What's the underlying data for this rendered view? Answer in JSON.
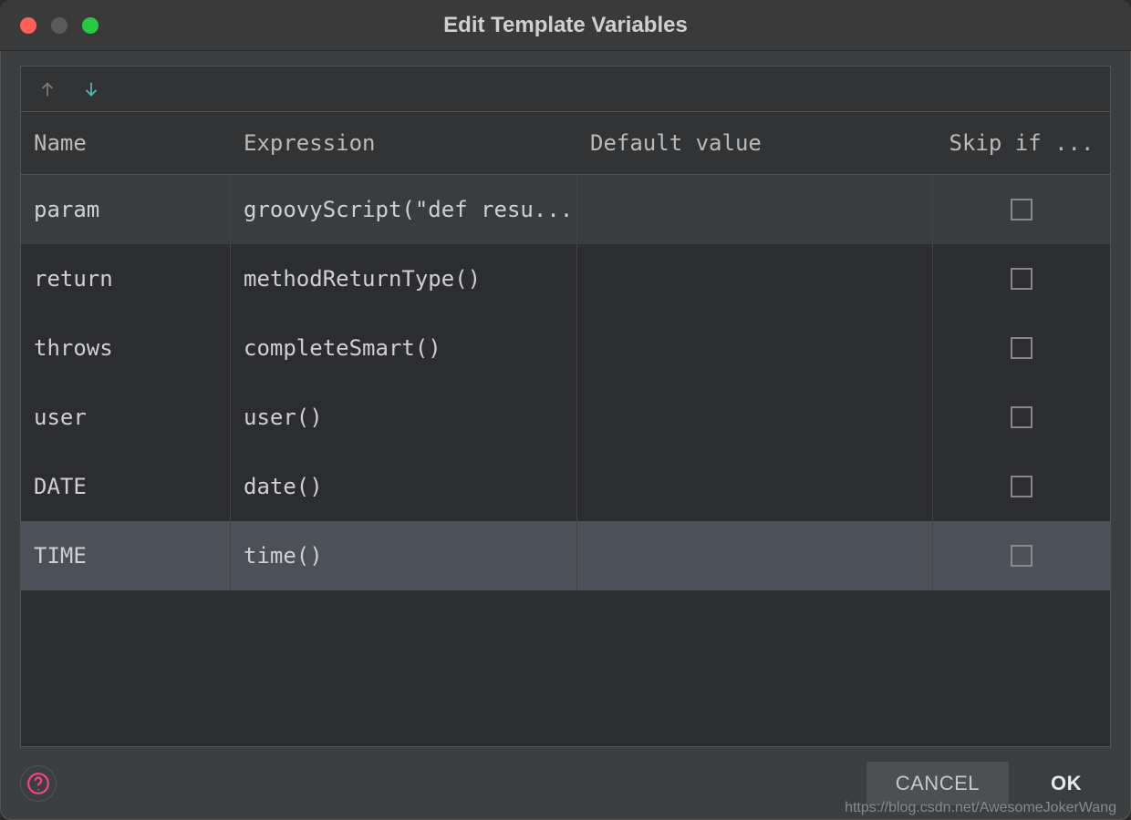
{
  "window": {
    "title": "Edit Template Variables"
  },
  "toolbar": {
    "up_label": "Move Up",
    "down_label": "Move Down"
  },
  "table": {
    "columns": {
      "name": "Name",
      "expression": "Expression",
      "default": "Default value",
      "skip": "Skip if ..."
    },
    "rows": [
      {
        "name": "param",
        "expression": "groovyScript(\"def resu...",
        "default": "",
        "skip": false,
        "state": "selected"
      },
      {
        "name": "return",
        "expression": "methodReturnType()",
        "default": "",
        "skip": false,
        "state": ""
      },
      {
        "name": "throws",
        "expression": "completeSmart()",
        "default": "",
        "skip": false,
        "state": ""
      },
      {
        "name": "user",
        "expression": "user()",
        "default": "",
        "skip": false,
        "state": ""
      },
      {
        "name": "DATE",
        "expression": "date()",
        "default": "",
        "skip": false,
        "state": ""
      },
      {
        "name": "TIME",
        "expression": "time()",
        "default": "",
        "skip": false,
        "state": "hover"
      }
    ]
  },
  "footer": {
    "cancel": "CANCEL",
    "ok": "OK",
    "watermark": "https://blog.csdn.net/AwesomeJokerWang"
  },
  "colors": {
    "accent_down": "#4db6ac",
    "help": "#ff4081"
  }
}
